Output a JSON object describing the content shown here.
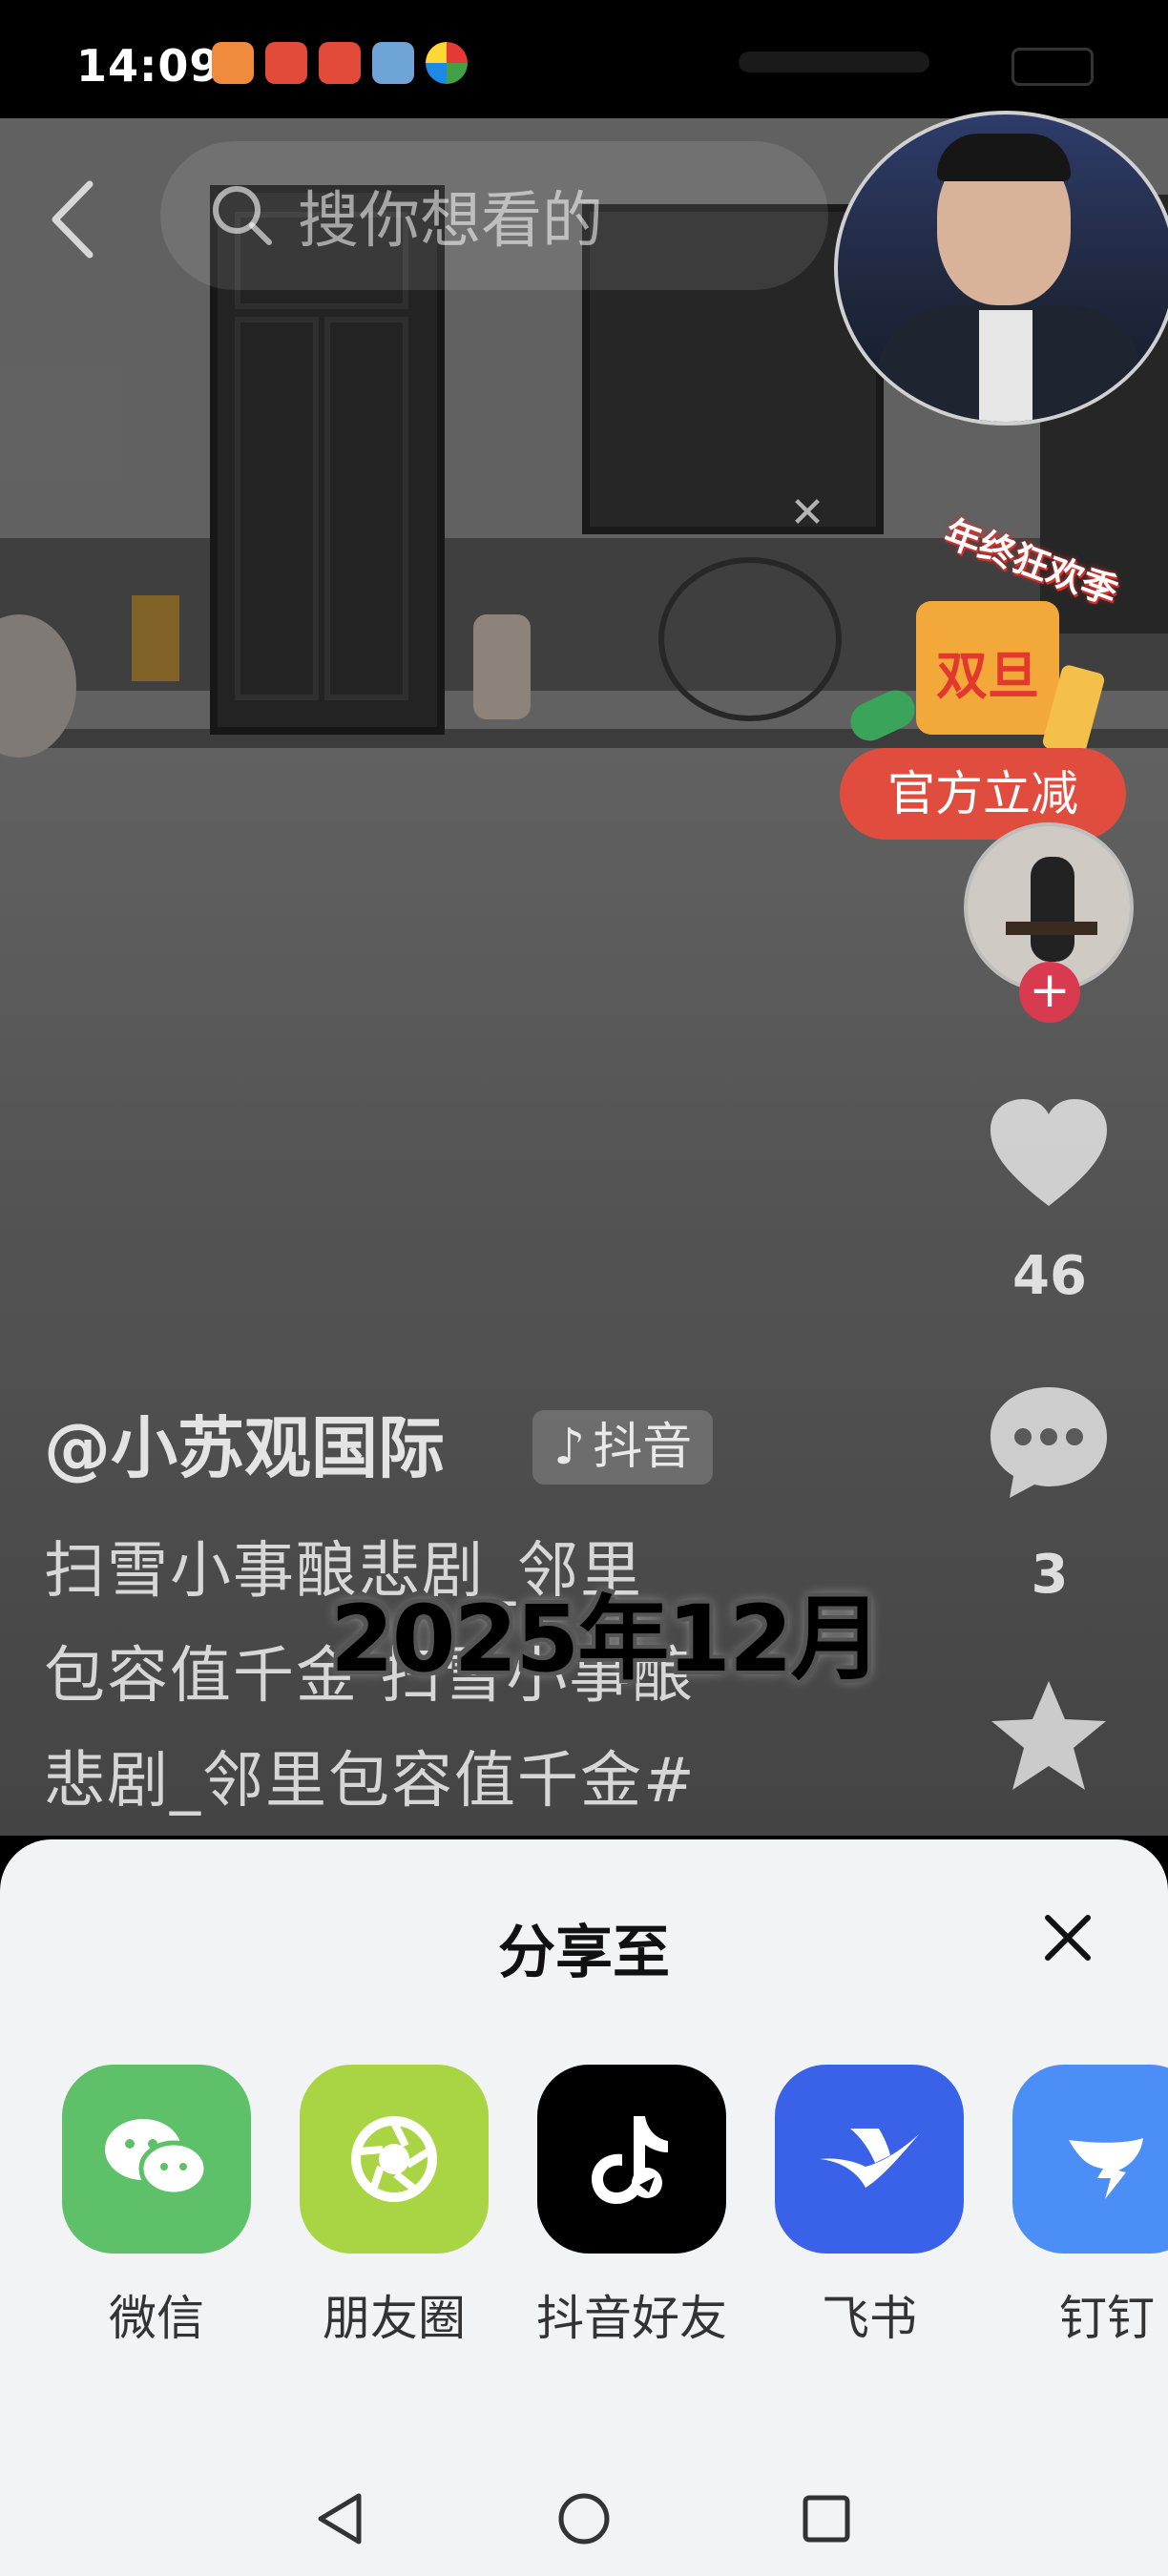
{
  "status_bar": {
    "time": "14:09",
    "app_icons": [
      "heart-app-icon",
      "red-app-icon",
      "red-app-icon",
      "game-app-icon",
      "colorful-app-icon"
    ]
  },
  "top_bar": {
    "search_placeholder": "搜你想看的"
  },
  "promo": {
    "tag": "年终狂欢季",
    "bag_text": "双旦",
    "pill": "官方立减"
  },
  "author": {
    "follow_symbol": "+"
  },
  "video": {
    "author_handle": "@小苏观国际",
    "platform_badge": "抖音",
    "caption_lines": [
      "扫雪小事酿悲剧_邻里",
      "包容值千金 扫雪小事酿",
      "悲剧_邻里包容值千金#"
    ],
    "overlay_text": "2025年12月",
    "like_count": "46",
    "comment_count": "3"
  },
  "share_sheet": {
    "title": "分享至",
    "targets": [
      {
        "label": "微信",
        "color": "#5ec16a",
        "icon": "wechat-icon"
      },
      {
        "label": "朋友圈",
        "color": "#a9d544",
        "icon": "moments-icon"
      },
      {
        "label": "抖音好友",
        "color": "#000000",
        "icon": "douyin-icon"
      },
      {
        "label": "飞书",
        "color": "#3a62e8",
        "icon": "feishu-icon"
      },
      {
        "label": "钉钉",
        "color": "#4b8ef5",
        "icon": "dingtalk-icon"
      }
    ]
  }
}
